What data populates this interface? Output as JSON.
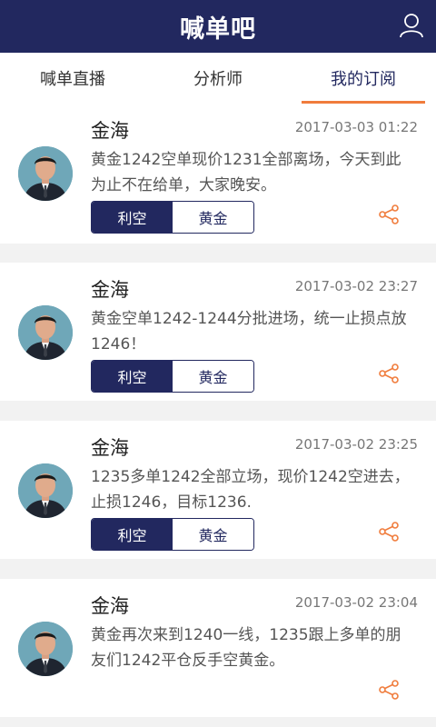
{
  "header": {
    "title": "喊单吧",
    "user_icon": "user-icon"
  },
  "tabs": [
    {
      "label": "喊单直播",
      "active": false
    },
    {
      "label": "分析师",
      "active": false
    },
    {
      "label": "我的订阅",
      "active": true
    }
  ],
  "colors": {
    "primary": "#22285f",
    "accent": "#f07c3c"
  },
  "posts": [
    {
      "author": "金海",
      "time": "2017-03-03 01:22",
      "content": "黄金1242空单现价1231全部离场，今天到此为止不在给单，大家晚安。",
      "direction": "利空",
      "symbol": "黄金",
      "show_tags": true
    },
    {
      "author": "金海",
      "time": "2017-03-02 23:27",
      "content": "黄金空单1242-1244分批进场，统一止损点放1246！",
      "direction": "利空",
      "symbol": "黄金",
      "show_tags": true
    },
    {
      "author": "金海",
      "time": "2017-03-02 23:25",
      "content": "1235多单1242全部立场，现价1242空进去，止损1246，目标1236.",
      "direction": "利空",
      "symbol": "黄金",
      "show_tags": true
    },
    {
      "author": "金海",
      "time": "2017-03-02 23:04",
      "content": "黄金再次来到1240一线，1235跟上多单的朋友们1242平仓反手空黄金。",
      "direction": "",
      "symbol": "",
      "show_tags": false
    }
  ]
}
